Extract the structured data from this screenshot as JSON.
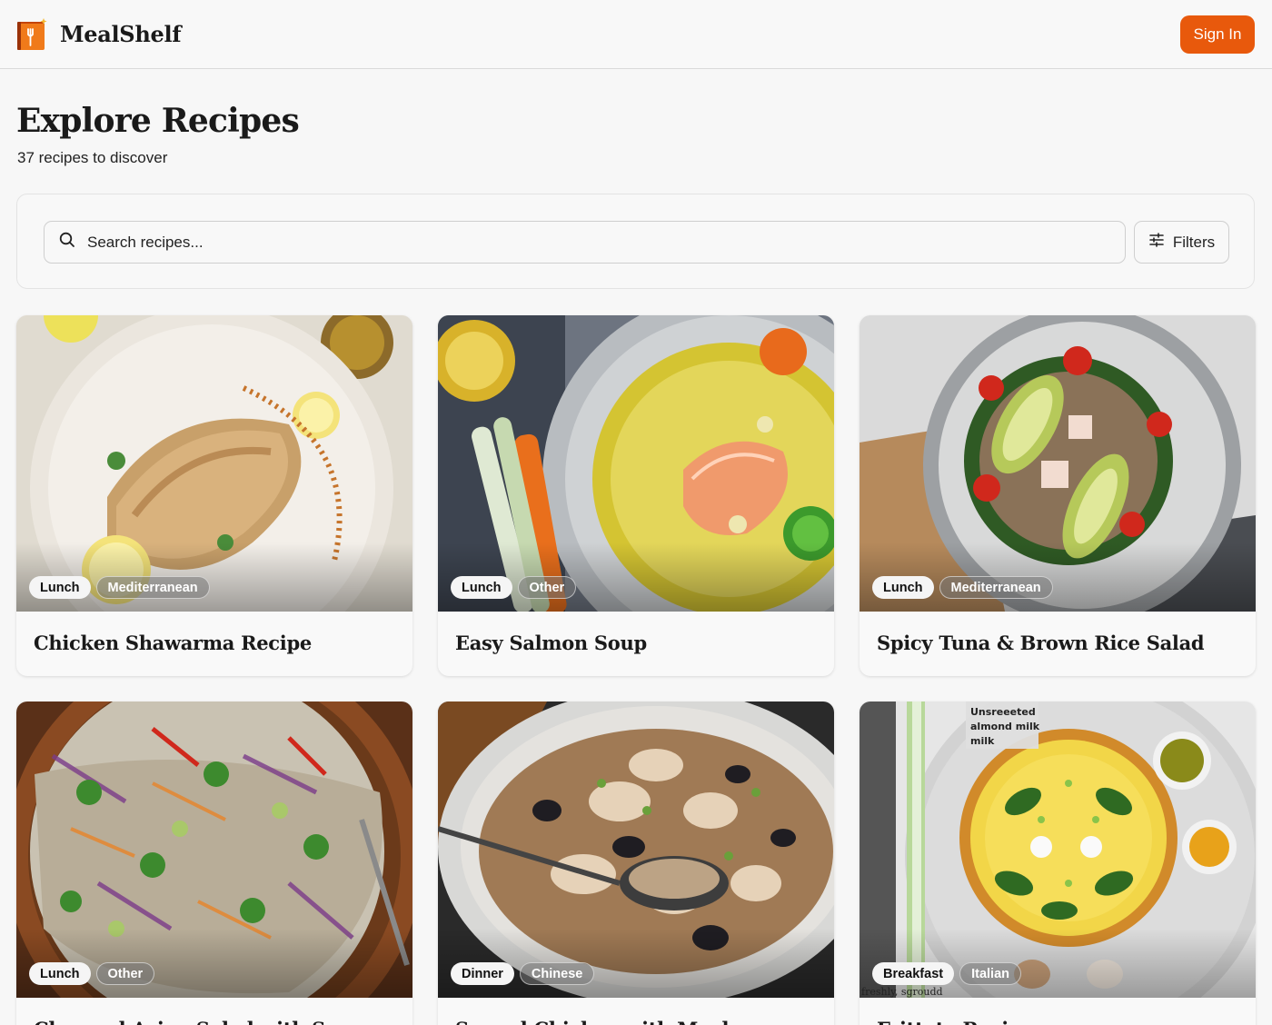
{
  "header": {
    "brand_name": "MealShelf",
    "sign_in_label": "Sign In",
    "accent_color": "#e8590c"
  },
  "page": {
    "title": "Explore Recipes",
    "subtitle": "37 recipes to discover"
  },
  "search": {
    "placeholder": "Search recipes...",
    "value": "",
    "filters_label": "Filters"
  },
  "recipes": [
    {
      "title": "Chicken Shawarma Recipe",
      "meal": "Lunch",
      "cuisine": "Mediterranean"
    },
    {
      "title": "Easy Salmon Soup",
      "meal": "Lunch",
      "cuisine": "Other"
    },
    {
      "title": "Spicy Tuna & Brown Rice Salad",
      "meal": "Lunch",
      "cuisine": "Mediterranean"
    },
    {
      "title": "Chopped Asian Salad with Sesame",
      "meal": "Lunch",
      "cuisine": "Other"
    },
    {
      "title": "Seared Chicken with Mushrooms",
      "meal": "Dinner",
      "cuisine": "Chinese"
    },
    {
      "title": "Frittata Recipe",
      "meal": "Breakfast",
      "cuisine": "Italian"
    }
  ],
  "image_text": {
    "frittata_label": "Unsreeeted almond milk milk",
    "frittata_bottom": "freshly, sgroudd"
  }
}
